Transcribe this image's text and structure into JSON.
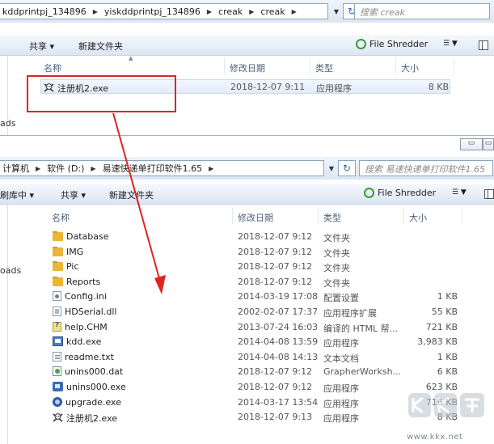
{
  "window1": {
    "breadcrumb": [
      "kddprintpj_134896",
      "yiskddprintpj_134896",
      "creak",
      "creak"
    ],
    "search_placeholder": "搜索 creak",
    "toolbar": {
      "share": "共享 ▾",
      "new_folder": "新建文件夹",
      "file_shredder": "File Shredder"
    },
    "nav_partial": "ads",
    "columns": {
      "name": "名称",
      "date": "修改日期",
      "type": "类型",
      "size": "大小"
    },
    "files": [
      {
        "name": "注册机2.exe",
        "date": "2018-12-07 9:11",
        "type": "应用程序",
        "size": "8 KB",
        "icon": "skull-icon"
      }
    ]
  },
  "window2": {
    "breadcrumb": [
      "计算机",
      "软件 (D:)",
      "易速快递单打印软件1.65"
    ],
    "search_placeholder": "搜索 易速快递单打印软件1.65",
    "toolbar": {
      "library": "刷库中 ▾",
      "share": "共享 ▾",
      "new_folder": "新建文件夹",
      "file_shredder": "File Shredder"
    },
    "nav_partial": "oads",
    "columns": {
      "name": "名称",
      "date": "修改日期",
      "type": "类型",
      "size": "大小"
    },
    "files": [
      {
        "name": "Database",
        "date": "2018-12-07 9:12",
        "type": "文件夹",
        "size": "",
        "icon": "folder-icon"
      },
      {
        "name": "IMG",
        "date": "2018-12-07 9:12",
        "type": "文件夹",
        "size": "",
        "icon": "folder-icon"
      },
      {
        "name": "Pic",
        "date": "2018-12-07 9:12",
        "type": "文件夹",
        "size": "",
        "icon": "folder-icon"
      },
      {
        "name": "Reports",
        "date": "2018-12-07 9:12",
        "type": "文件夹",
        "size": "",
        "icon": "folder-icon"
      },
      {
        "name": "Config.ini",
        "date": "2014-03-19 17:08",
        "type": "配置设置",
        "size": "1 KB",
        "icon": "config-file-icon"
      },
      {
        "name": "HDSerial.dll",
        "date": "2002-02-07 17:37",
        "type": "应用程序扩展",
        "size": "55 KB",
        "icon": "dll-file-icon"
      },
      {
        "name": "help.CHM",
        "date": "2013-07-24 16:03",
        "type": "编译的 HTML 帮...",
        "size": "721 KB",
        "icon": "chm-file-icon"
      },
      {
        "name": "kdd.exe",
        "date": "2014-04-08 13:59",
        "type": "应用程序",
        "size": "3,983 KB",
        "icon": "exe-file-icon"
      },
      {
        "name": "readme.txt",
        "date": "2014-04-08 14:13",
        "type": "文本文档",
        "size": "1 KB",
        "icon": "text-file-icon"
      },
      {
        "name": "unins000.dat",
        "date": "2018-12-07 9:12",
        "type": "GrapherWorksh...",
        "size": "6 KB",
        "icon": "dat-file-icon"
      },
      {
        "name": "unins000.exe",
        "date": "2018-12-07 9:12",
        "type": "应用程序",
        "size": "623 KB",
        "icon": "uninstaller-icon"
      },
      {
        "name": "upgrade.exe",
        "date": "2014-03-17 13:54",
        "type": "应用程序",
        "size": "716 KB",
        "icon": "upgrade-icon"
      },
      {
        "name": "注册机2.exe",
        "date": "2018-12-07 9:13",
        "type": "应用程序",
        "size": "8 KB",
        "icon": "skull-icon"
      }
    ]
  },
  "watermark": {
    "text": "www.kkx.net"
  },
  "colors": {
    "highlight_box": "#e02323",
    "arrow": "#e02323",
    "folder": "#e9b53b"
  }
}
